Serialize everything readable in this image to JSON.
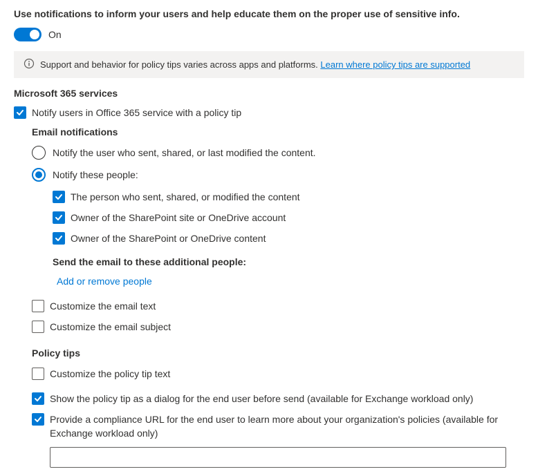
{
  "heading": "Use notifications to inform your users and help educate them on the proper use of sensitive info.",
  "toggle": {
    "label": "On",
    "state": true
  },
  "infoBanner": {
    "text": "Support and behavior for policy tips varies across apps and platforms. ",
    "linkText": "Learn where policy tips are supported"
  },
  "sections": {
    "m365": {
      "title": "Microsoft 365 services",
      "notifyCheckbox": {
        "checked": true,
        "label": "Notify users in Office 365 service with a policy tip"
      },
      "emailNotifications": {
        "title": "Email notifications",
        "radios": {
          "sender": {
            "selected": false,
            "label": "Notify the user who sent, shared, or last modified the content."
          },
          "people": {
            "selected": true,
            "label": "Notify these people:"
          }
        },
        "peopleChecks": {
          "person": {
            "checked": true,
            "label": "The person who sent, shared, or modified the content"
          },
          "siteOwner": {
            "checked": true,
            "label": "Owner of the SharePoint site or OneDrive account"
          },
          "contentOwner": {
            "checked": true,
            "label": "Owner of the SharePoint or OneDrive content"
          }
        },
        "additionalPeople": {
          "heading": "Send the email to these additional people:",
          "linkLabel": "Add or remove people"
        },
        "customizeText": {
          "checked": false,
          "label": "Customize the email text"
        },
        "customizeSubject": {
          "checked": false,
          "label": "Customize the email subject"
        }
      },
      "policyTips": {
        "title": "Policy tips",
        "customizeTipText": {
          "checked": false,
          "label": "Customize the policy tip text"
        },
        "showDialog": {
          "checked": true,
          "label": "Show the policy tip as a dialog for the end user before send (available for Exchange workload only)"
        },
        "complianceUrl": {
          "checked": true,
          "label": "Provide a compliance URL for the end user to learn more about your organization's policies (available for Exchange workload only)",
          "value": ""
        }
      }
    }
  }
}
